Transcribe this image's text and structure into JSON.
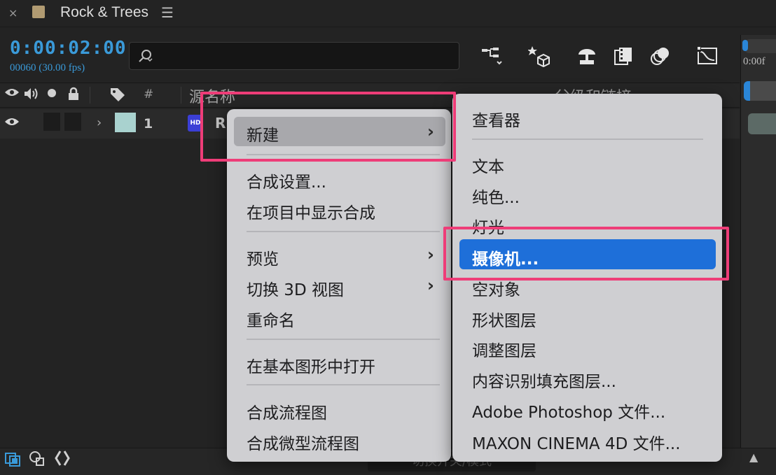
{
  "tab": {
    "close": "×",
    "title": "Rock & Trees",
    "menu": "☰"
  },
  "timeline": {
    "timecode": "0:00:02:00",
    "frames": "00060 (30.00 fps)",
    "search_placeholder": "",
    "right_frame_label": "0:00f"
  },
  "columns": {
    "hash": "#",
    "source_name": "源名称",
    "parent": "父级和链接"
  },
  "layer": {
    "number": "1",
    "name_partial": "R",
    "icon_text": "HD",
    "label_color": "#a9d2cf"
  },
  "bottom": {
    "toggle_label": "切换开关/模式"
  },
  "context_menu": {
    "items": [
      {
        "label": "新建",
        "submenu": true
      },
      {
        "label": "合成设置..."
      },
      {
        "label": "在项目中显示合成"
      },
      {
        "label": "预览",
        "submenu": true
      },
      {
        "label": "切换 3D 视图",
        "submenu": true
      },
      {
        "label": "重命名"
      },
      {
        "label": "在基本图形中打开"
      },
      {
        "label": "合成流程图"
      },
      {
        "label": "合成微型流程图"
      }
    ]
  },
  "submenu": {
    "items": [
      {
        "label": "查看器"
      },
      {
        "label": "文本"
      },
      {
        "label": "纯色..."
      },
      {
        "label": "灯光"
      },
      {
        "label": "摄像机..."
      },
      {
        "label": "空对象"
      },
      {
        "label": "形状图层"
      },
      {
        "label": "调整图层"
      },
      {
        "label": "内容识别填充图层..."
      },
      {
        "label": "Adobe Photoshop 文件..."
      },
      {
        "label": "MAXON CINEMA 4D 文件..."
      }
    ]
  },
  "colors": {
    "accent_blue": "#3a9ad9",
    "highlight_blue": "#1e6fd9",
    "annotation_pink": "#ee3d78",
    "menu_bg": "#cfcfd2"
  }
}
